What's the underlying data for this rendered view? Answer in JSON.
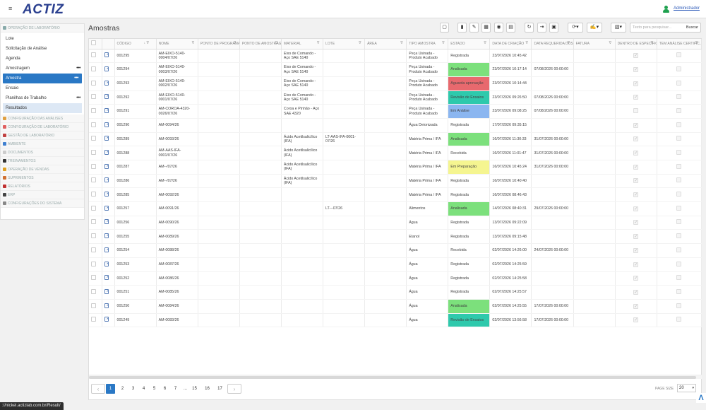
{
  "header": {
    "logo_text": "ACTIZ",
    "user_label": "Administrador"
  },
  "sidebar": {
    "top_section": "OPERAÇÃO DE LABORATÓRIO",
    "items": [
      {
        "label": "Lote",
        "dots": ""
      },
      {
        "label": "Solicitação de Análise",
        "dots": ""
      },
      {
        "label": "Agenda",
        "dots": ""
      },
      {
        "label": "Amostragem",
        "dots": "•••"
      },
      {
        "label": "Amostra",
        "dots": "•••"
      },
      {
        "label": "Ensaio",
        "dots": ""
      },
      {
        "label": "Planilhas de Trabalho",
        "dots": "•••"
      },
      {
        "label": "Resultados",
        "dots": ""
      }
    ],
    "sections": [
      {
        "label": "CONFIGURAÇÃO DAS ANÁLISES",
        "color": "#e0a040"
      },
      {
        "label": "CONFIGURAÇÃO DE LABORATÓRIO",
        "color": "#e06060"
      },
      {
        "label": "GESTÃO DE LABORATÓRIO",
        "color": "#c04040"
      },
      {
        "label": "AMBIENTE",
        "color": "#4080d0"
      },
      {
        "label": "DOCUMENTOS",
        "color": "#cccccc"
      },
      {
        "label": "TREINAMENTOS",
        "color": "#333333"
      },
      {
        "label": "OPERAÇÃO DE VENDAS",
        "color": "#e0a020"
      },
      {
        "label": "SUPRIMENTOS",
        "color": "#d07030"
      },
      {
        "label": "RELATÓRIOS",
        "color": "#c03030"
      },
      {
        "label": "ERP",
        "color": "#444444"
      },
      {
        "label": "CONFIGURAÇÕES DO SISTEMA",
        "color": "#888888"
      }
    ]
  },
  "page": {
    "title": "Amostras"
  },
  "search": {
    "placeholder": "Texto para pesquisar...",
    "button": "Buscar"
  },
  "columns": [
    "CÓDIGO",
    "NOME",
    "PONTO DE PROGRAMA...",
    "PONTO DE AMOSTRAGE...",
    "MATERIAL",
    "LOTE",
    "ÁREA",
    "TIPO AMOSTRA",
    "ESTADO",
    "DATA DE CRIAÇÃO",
    "DATA REQUERIDA DOS...",
    "FATURA",
    "DENTRO DE ESPECIFIC...",
    "TEM ANÁLISE CERTIFIC..."
  ],
  "rows": [
    {
      "codigo": "001295",
      "nome": "AM-EIXO-5140-0004/07/26",
      "material": "Eixo de Comando - Aço SAE 5140",
      "lote": "",
      "tipo": "Peça Usinada - Produto Acabado",
      "estado": "Registrada",
      "estado_color": "",
      "criacao": "23/07/2026 10:45:42",
      "requerida": "",
      "dentro": true
    },
    {
      "codigo": "001294",
      "nome": "AM-EIXO-5140-0003/07/26",
      "material": "Eixo de Comando - Aço SAE 5140",
      "lote": "",
      "tipo": "Peça Usinada - Produto Acabado",
      "estado": "Analisada",
      "estado_color": "green",
      "criacao": "23/07/2026 10:17:14",
      "requerida": "07/08/2026 00:00:00",
      "dentro": true
    },
    {
      "codigo": "001293",
      "nome": "AM-EIXO-5140-0002/07/26",
      "material": "Eixo de Comando - Aço SAE 5140",
      "lote": "",
      "tipo": "Peça Usinada - Produto Acabado",
      "estado": "Aguarda aprovação",
      "estado_color": "red",
      "criacao": "23/07/2026 10:14:44",
      "requerida": "",
      "dentro": true
    },
    {
      "codigo": "001292",
      "nome": "AM-EIXO-5140-0001/07/26",
      "material": "Eixo de Comando - Aço SAE 5140",
      "lote": "",
      "tipo": "Peça Usinada - Produto Acabado",
      "estado": "Revisão de Ensaios",
      "estado_color": "teal",
      "criacao": "23/07/2026 09:26:50",
      "requerida": "07/08/2026 00:00:00",
      "dentro": true
    },
    {
      "codigo": "001291",
      "nome": "AM-COROA-4320-0026/07/26",
      "material": "Coroa e Pinhão - Aço SAE 4320",
      "lote": "",
      "tipo": "Peça Usinada - Produto Acabado",
      "estado": "Em Análise",
      "estado_color": "blue",
      "criacao": "23/07/2026 09:08:25",
      "requerida": "07/08/2026 00:00:00",
      "dentro": false
    },
    {
      "codigo": "001290",
      "nome": "AM-0094/26",
      "material": "",
      "lote": "",
      "tipo": "Água Deionizada",
      "estado": "Registrada",
      "estado_color": "",
      "criacao": "17/07/2026 09:35:15",
      "requerida": "",
      "dentro": true
    },
    {
      "codigo": "001289",
      "nome": "AM-0093/26",
      "material": "Ácido Acetilsalicílico (IFA)",
      "lote": "LT-AAS-IFA-0001-07/26",
      "tipo": "Matéria Prima / IFA",
      "estado": "Analisada",
      "estado_color": "green",
      "criacao": "16/07/2026 11:30:33",
      "requerida": "31/07/2026 00:00:00",
      "dentro": true
    },
    {
      "codigo": "001288",
      "nome": "AM-AAS-IFA-0001/07/26",
      "material": "Ácido Acetilsalicílico (IFA)",
      "lote": "",
      "tipo": "Matéria Prima / IFA",
      "estado": "Recebida",
      "estado_color": "",
      "criacao": "16/07/2026 11:01:47",
      "requerida": "31/07/2026 00:00:00",
      "dentro": true
    },
    {
      "codigo": "001287",
      "nome": "AM--/07/26",
      "material": "Ácido Acetilsalicílico (IFA)",
      "lote": "",
      "tipo": "Matéria Prima / IFA",
      "estado": "Em Preparação",
      "estado_color": "yellow",
      "criacao": "16/07/2026 10:45:24",
      "requerida": "31/07/2026 00:00:00",
      "dentro": true
    },
    {
      "codigo": "001286",
      "nome": "AM--/07/26",
      "material": "Ácido Acetilsalicílico (IFA)",
      "lote": "",
      "tipo": "Matéria Prima / IFA",
      "estado": "Registrada",
      "estado_color": "",
      "criacao": "16/07/2026 10:40:40",
      "requerida": "",
      "dentro": true
    },
    {
      "codigo": "001285",
      "nome": "AM-0092/26",
      "material": "",
      "lote": "",
      "tipo": "Matéria Prima / IFA",
      "estado": "Registrada",
      "estado_color": "",
      "criacao": "16/07/2026 08:46:43",
      "requerida": "",
      "dentro": true
    },
    {
      "codigo": "001257",
      "nome": "AM-0091/26",
      "material": "",
      "lote": "LT---07/26",
      "tipo": "Alimentos",
      "estado": "Analisada",
      "estado_color": "green",
      "criacao": "14/07/2026 08:40:31",
      "requerida": "29/07/2026 00:00:00",
      "dentro": true
    },
    {
      "codigo": "001256",
      "nome": "AM-0090/26",
      "material": "",
      "lote": "",
      "tipo": "Água",
      "estado": "Registrada",
      "estado_color": "",
      "criacao": "13/07/2026 09:22:09",
      "requerida": "",
      "dentro": true
    },
    {
      "codigo": "001255",
      "nome": "AM-0089/26",
      "material": "",
      "lote": "",
      "tipo": "Etanol",
      "estado": "Registrada",
      "estado_color": "",
      "criacao": "13/07/2026 09:15:48",
      "requerida": "",
      "dentro": true
    },
    {
      "codigo": "001254",
      "nome": "AM-0088/26",
      "material": "",
      "lote": "",
      "tipo": "Água",
      "estado": "Recebida",
      "estado_color": "",
      "criacao": "02/07/2026 14:26:00",
      "requerida": "24/07/2026 00:00:00",
      "dentro": true
    },
    {
      "codigo": "001253",
      "nome": "AM-0087/26",
      "material": "",
      "lote": "",
      "tipo": "Água",
      "estado": "Registrada",
      "estado_color": "",
      "criacao": "02/07/2026 14:25:59",
      "requerida": "",
      "dentro": true
    },
    {
      "codigo": "001252",
      "nome": "AM-0086/26",
      "material": "",
      "lote": "",
      "tipo": "Água",
      "estado": "Registrada",
      "estado_color": "",
      "criacao": "02/07/2026 14:25:58",
      "requerida": "",
      "dentro": true
    },
    {
      "codigo": "001251",
      "nome": "AM-0085/26",
      "material": "",
      "lote": "",
      "tipo": "Água",
      "estado": "Registrada",
      "estado_color": "",
      "criacao": "02/07/2026 14:25:57",
      "requerida": "",
      "dentro": true
    },
    {
      "codigo": "001250",
      "nome": "AM-0084/26",
      "material": "",
      "lote": "",
      "tipo": "Água",
      "estado": "Analisada",
      "estado_color": "green",
      "criacao": "02/07/2026 14:25:55",
      "requerida": "17/07/2026 00:00:00",
      "dentro": true
    },
    {
      "codigo": "001249",
      "nome": "AM-0083/26",
      "material": "",
      "lote": "",
      "tipo": "Água",
      "estado": "Revisão de Ensaios",
      "estado_color": "teal",
      "criacao": "02/07/2026 13:56:58",
      "requerida": "17/07/2026 00:00:00",
      "dentro": true
    }
  ],
  "pagination": {
    "prev": "‹",
    "next": "›",
    "pages": [
      "1",
      "2",
      "3",
      "4",
      "5",
      "6",
      "7",
      "...",
      "15",
      "16",
      "17"
    ],
    "current": "1",
    "page_size_label": "PAGE SIZE",
    "page_size": "20"
  },
  "statusbar": {
    "url": "://nickel.actizlab.com.br/Result/"
  },
  "fab_label": "Λ"
}
